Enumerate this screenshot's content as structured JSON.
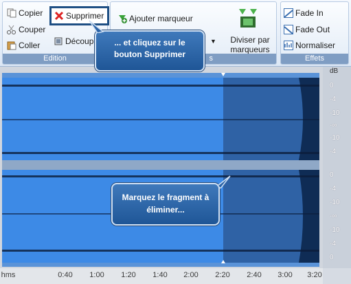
{
  "ribbon": {
    "edition": {
      "label": "Edition",
      "copy": "Copier",
      "cut": "Couper",
      "paste": "Coller",
      "delete": "Supprimer",
      "crop": "Découp"
    },
    "markers": {
      "add_marker": "Ajouter marqueur",
      "label_fragment": "s",
      "split": "Diviser par marqueurs"
    },
    "effects": {
      "label": "Effets",
      "fade_in": "Fade In",
      "fade_out": "Fade Out",
      "normalize": "Normaliser"
    }
  },
  "callouts": {
    "top": "... et cliquez sur le bouton Supprimer",
    "middle": "Marquez le fragment à éliminer..."
  },
  "timeline": {
    "ticks": [
      "hms",
      "0:40",
      "1:00",
      "1:20",
      "1:40",
      "2:00",
      "2:20",
      "2:40",
      "3:00",
      "3:20"
    ]
  },
  "db_scale": {
    "unit": "dB",
    "labels": [
      "0",
      "-4",
      "-10",
      "-∞",
      "-10",
      "-4",
      "0",
      "-4",
      "-10",
      "-∞",
      "-10",
      "-4",
      "0"
    ]
  },
  "colors": {
    "wave": "#3d8ae6",
    "selection": "#2e5f9c",
    "wave_dark": "#0b1d3a"
  }
}
